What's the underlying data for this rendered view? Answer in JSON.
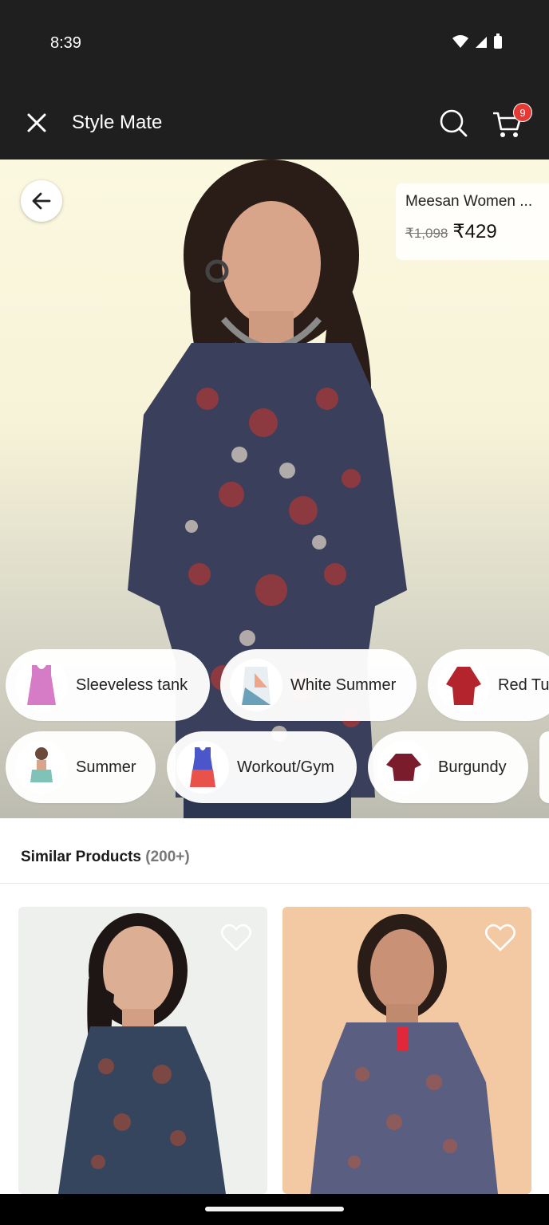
{
  "status_bar": {
    "time": "8:39"
  },
  "app_bar": {
    "title": "Style Mate",
    "cart_count": "9"
  },
  "product": {
    "name": "Meesan Women ...",
    "original_price": "₹1,098",
    "price": "₹429"
  },
  "chips": [
    {
      "label": "Sleeveless tank",
      "icon": "pink-tank-top"
    },
    {
      "label": "White Summer",
      "icon": "white-summer-top"
    },
    {
      "label": "Red Tu",
      "icon": "red-tunic"
    },
    {
      "label": "Summer",
      "icon": "summer-top"
    },
    {
      "label": "Workout/Gym",
      "icon": "gym-tank"
    },
    {
      "label": "Burgundy",
      "icon": "burgundy-top"
    }
  ],
  "similar": {
    "title": "Similar Products",
    "count": "(200+)"
  },
  "colors": {
    "app_bar": "#1f1f1f",
    "badge": "#e53935"
  }
}
